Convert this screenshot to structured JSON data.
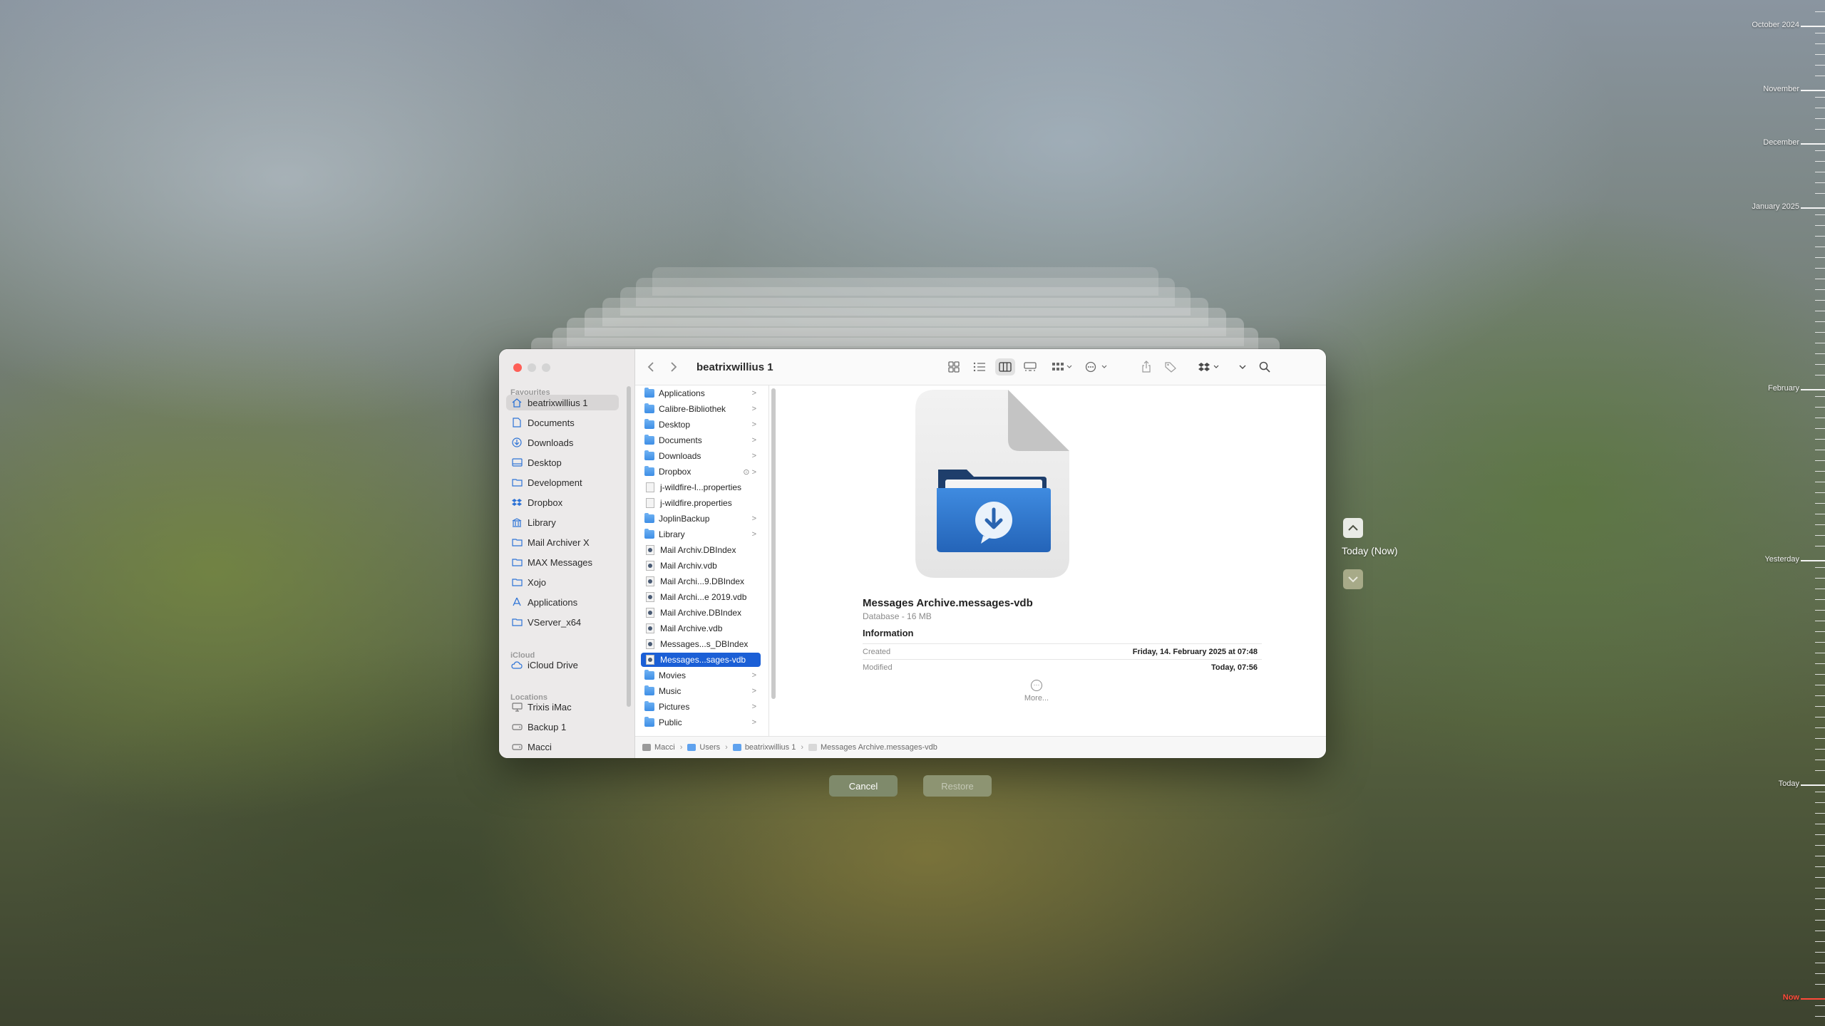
{
  "finder": {
    "title": "beatrixwillius 1",
    "sidebar": {
      "favourites_label": "Favourites",
      "favourites": [
        {
          "label": "beatrixwillius 1",
          "icon": "home-icon"
        },
        {
          "label": "Documents",
          "icon": "document-icon"
        },
        {
          "label": "Downloads",
          "icon": "download-icon"
        },
        {
          "label": "Desktop",
          "icon": "desktop-icon"
        },
        {
          "label": "Development",
          "icon": "folder-icon"
        },
        {
          "label": "Dropbox",
          "icon": "dropbox-icon"
        },
        {
          "label": "Library",
          "icon": "library-icon"
        },
        {
          "label": "Mail Archiver X",
          "icon": "folder-icon"
        },
        {
          "label": "MAX Messages",
          "icon": "folder-icon"
        },
        {
          "label": "Xojo",
          "icon": "folder-icon"
        },
        {
          "label": "Applications",
          "icon": "applications-icon"
        },
        {
          "label": "VServer_x64",
          "icon": "folder-icon"
        }
      ],
      "icloud_label": "iCloud",
      "icloud": [
        {
          "label": "iCloud Drive",
          "icon": "cloud-icon"
        }
      ],
      "locations_label": "Locations",
      "locations": [
        {
          "label": "Trixis iMac",
          "icon": "computer-icon"
        },
        {
          "label": "Backup 1",
          "icon": "disk-icon"
        },
        {
          "label": "Macci",
          "icon": "disk-icon"
        }
      ]
    },
    "column": [
      {
        "label": "Applications",
        "kind": "folder",
        "chevron": ">"
      },
      {
        "label": "Calibre-Bibliothek",
        "kind": "folder",
        "chevron": ">"
      },
      {
        "label": "Desktop",
        "kind": "folder",
        "chevron": ">"
      },
      {
        "label": "Documents",
        "kind": "folder",
        "chevron": ">"
      },
      {
        "label": "Downloads",
        "kind": "folder",
        "chevron": ">"
      },
      {
        "label": "Dropbox",
        "kind": "folder",
        "chevron": "⊙ >"
      },
      {
        "label": "j-wildfire-l...properties",
        "kind": "doc",
        "chevron": ""
      },
      {
        "label": "j-wildfire.properties",
        "kind": "doc",
        "chevron": ""
      },
      {
        "label": "JoplinBackup",
        "kind": "folder",
        "chevron": ">"
      },
      {
        "label": "Library",
        "kind": "folder",
        "chevron": ">"
      },
      {
        "label": "Mail Archiv.DBIndex",
        "kind": "db",
        "chevron": ""
      },
      {
        "label": "Mail Archiv.vdb",
        "kind": "db",
        "chevron": ""
      },
      {
        "label": "Mail Archi...9.DBIndex",
        "kind": "db",
        "chevron": ""
      },
      {
        "label": "Mail Archi...e 2019.vdb",
        "kind": "db",
        "chevron": ""
      },
      {
        "label": "Mail Archive.DBIndex",
        "kind": "db",
        "chevron": ""
      },
      {
        "label": "Mail Archive.vdb",
        "kind": "db",
        "chevron": ""
      },
      {
        "label": "Messages...s_DBIndex",
        "kind": "db",
        "chevron": ""
      },
      {
        "label": "Messages...sages-vdb",
        "kind": "db",
        "chevron": "",
        "selected": true
      },
      {
        "label": "Movies",
        "kind": "folder",
        "chevron": ">"
      },
      {
        "label": "Music",
        "kind": "folder",
        "chevron": ">"
      },
      {
        "label": "Pictures",
        "kind": "folder",
        "chevron": ">"
      },
      {
        "label": "Public",
        "kind": "folder",
        "chevron": ">"
      }
    ],
    "preview": {
      "name": "Messages Archive.messages-vdb",
      "kind": "Database - 16 MB",
      "info_heading": "Information",
      "created_label": "Created",
      "created_value": "Friday, 14. February 2025 at 07:48",
      "modified_label": "Modified",
      "modified_value": "Today, 07:56",
      "more_label": "More..."
    },
    "path": [
      "Macci",
      "Users",
      "beatrixwillius 1",
      "Messages Archive.messages-vdb"
    ],
    "path_sep": "›"
  },
  "buttons": {
    "cancel": "Cancel",
    "restore": "Restore"
  },
  "navigator": {
    "current": "Today (Now)"
  },
  "timeline": {
    "labels": [
      "October 2024",
      "November",
      "December",
      "January 2025",
      "February",
      "Yesterday",
      "Today",
      "Now"
    ]
  },
  "colors": {
    "accent": "#1b5fd6",
    "close": "#fe5f57",
    "now": "#ff4a3a"
  }
}
